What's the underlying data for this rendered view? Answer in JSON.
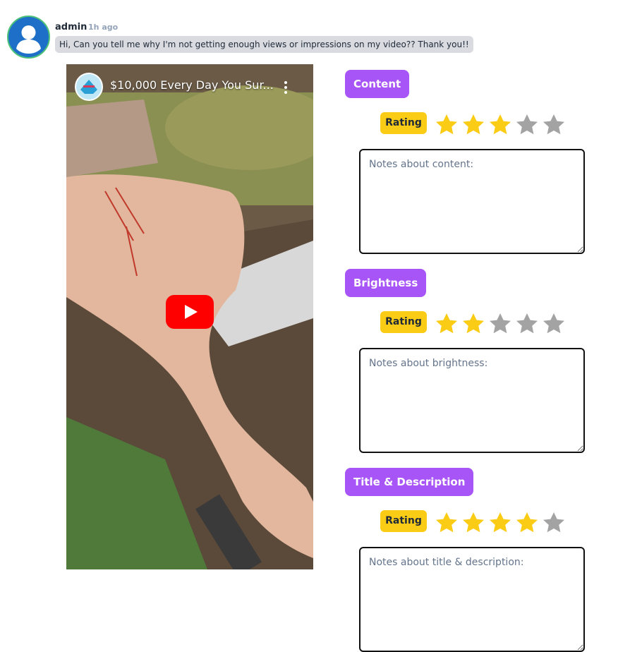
{
  "comment": {
    "username": "admin",
    "time": "1h ago",
    "message": "Hi, Can you tell me why I'm not getting enough views or impressions on my video?? Thank you!!"
  },
  "video": {
    "title": "$10,000 Every Day You Sur...",
    "icons": [
      "channel-avatar-icon",
      "more-vert-icon",
      "youtube-play-icon"
    ]
  },
  "sections": [
    {
      "label": "Content",
      "rating_label": "Rating",
      "rating": 3,
      "max": 5,
      "placeholder": "Notes about content:"
    },
    {
      "label": "Brightness",
      "rating_label": "Rating",
      "rating": 2,
      "max": 5,
      "placeholder": "Notes about brightness:"
    },
    {
      "label": "Title & Description",
      "rating_label": "Rating",
      "rating": 4,
      "max": 5,
      "placeholder": "Notes about title & description:"
    }
  ],
  "colors": {
    "accent": "#a855f7",
    "rating_badge": "#facc15",
    "star_on": "#facc15",
    "star_off": "#a3a3a3"
  }
}
